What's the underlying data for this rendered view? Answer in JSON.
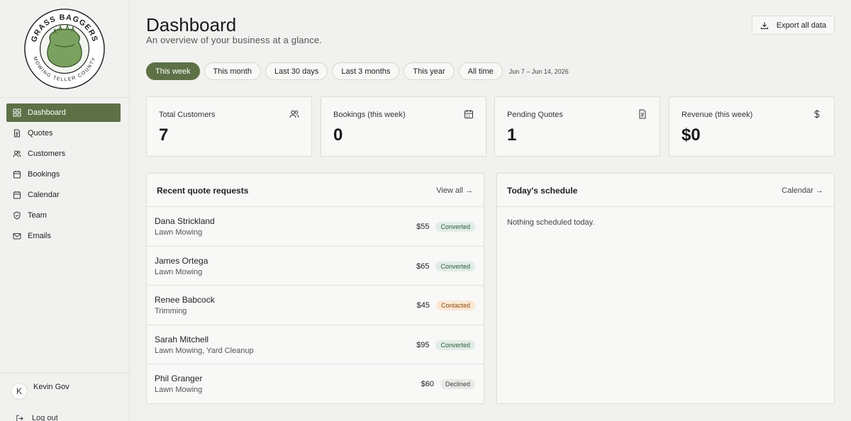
{
  "brand": {
    "logo_top_text": "GRASS BAGGERS",
    "logo_bottom_text": "MOWING TELLER COUNTY"
  },
  "sidebar": {
    "items": [
      {
        "label": "Dashboard",
        "icon": "dashboard-icon",
        "active": true
      },
      {
        "label": "Quotes",
        "icon": "document-icon"
      },
      {
        "label": "Customers",
        "icon": "users-icon"
      },
      {
        "label": "Bookings",
        "icon": "calendar-icon"
      },
      {
        "label": "Calendar",
        "icon": "calendar-icon"
      },
      {
        "label": "Team",
        "icon": "shield-icon"
      },
      {
        "label": "Emails",
        "icon": "mail-icon"
      }
    ]
  },
  "user": {
    "initial": "K",
    "name": "Kevin Gov",
    "logout_label": "Log out"
  },
  "header": {
    "title": "Dashboard",
    "subtitle": "An overview of your business at a glance.",
    "export_label": "Export all data"
  },
  "filters": {
    "options": [
      "This week",
      "This month",
      "Last 30 days",
      "Last 3 months",
      "This year",
      "All time"
    ],
    "selected": "This week",
    "date_range": "Jun 7 – Jun 14, 2026"
  },
  "stats": [
    {
      "label": "Total Customers",
      "value": "7",
      "icon": "users-icon"
    },
    {
      "label": "Bookings (this week)",
      "value": "0",
      "icon": "calendar-icon"
    },
    {
      "label": "Pending Quotes",
      "value": "1",
      "icon": "document-icon"
    },
    {
      "label": "Revenue (this week)",
      "value": "$0",
      "icon": "dollar-icon"
    }
  ],
  "quotes_panel": {
    "title": "Recent quote requests",
    "link": "View all →",
    "rows": [
      {
        "name": "Dana Strickland",
        "service": "Lawn Mowing",
        "amount": "$55",
        "status": "Converted"
      },
      {
        "name": "James Ortega",
        "service": "Lawn Mowing",
        "amount": "$65",
        "status": "Converted"
      },
      {
        "name": "Renee Babcock",
        "service": "Trimming",
        "amount": "$45",
        "status": "Contacted"
      },
      {
        "name": "Sarah Mitchell",
        "service": "Lawn Mowing, Yard Cleanup",
        "amount": "$95",
        "status": "Converted"
      },
      {
        "name": "Phil Granger",
        "service": "Lawn Mowing",
        "amount": "$60",
        "status": "Declined"
      }
    ]
  },
  "schedule_panel": {
    "title": "Today's schedule",
    "link": "Calendar →",
    "empty_text": "Nothing scheduled today."
  },
  "colors": {
    "accent": "#5d7046",
    "logo_green": "#7ba160",
    "converted_bg": "#e1ece6",
    "contacted_bg": "#fbe8d4",
    "declined_bg": "#e8e8e6"
  }
}
